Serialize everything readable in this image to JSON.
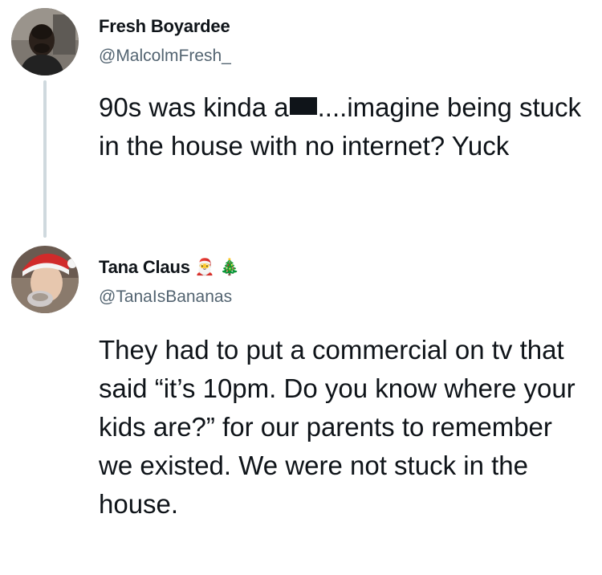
{
  "tweet1": {
    "display_name": "Fresh Boyardee",
    "handle": "@MalcolmFresh_",
    "text_before_redaction": "90s was kinda a",
    "text_after_redaction": "....imagine being stuck in the house with no internet? Yuck"
  },
  "tweet2": {
    "display_name": "Tana Claus",
    "name_emojis": [
      "🎅",
      "🎄"
    ],
    "handle": "@TanaIsBananas",
    "text": "They had to put a commercial on tv that said “it’s 10pm. Do you know where your kids are?” for our parents to remember we existed. We were not stuck in the house."
  },
  "icons": {
    "avatar1": "profile-photo-man",
    "avatar2": "profile-photo-woman-santa-hat"
  }
}
